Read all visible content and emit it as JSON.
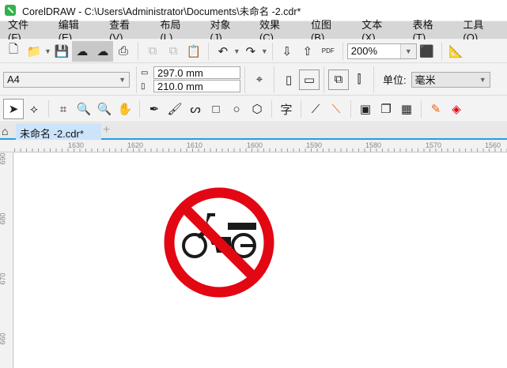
{
  "window": {
    "title": "CorelDRAW - C:\\Users\\Administrator\\Documents\\未命名 -2.cdr*"
  },
  "menu": [
    "文件(F)",
    "编辑(E)",
    "查看(V)",
    "布局(L)",
    "对象(J)",
    "效果(C)",
    "位图(B)",
    "文本(X)",
    "表格(T)",
    "工具(O)"
  ],
  "toolbar": {
    "zoom": "200%",
    "pdf_label": "PDF"
  },
  "property_bar": {
    "page_size": "A4",
    "width": "297.0 mm",
    "height": "210.0 mm",
    "units_label": "单位:",
    "units": "毫米"
  },
  "tabs": [
    {
      "label": "未命名 -2.cdr*"
    }
  ],
  "ruler": {
    "h": [
      "1630",
      "1620",
      "1610",
      "1600",
      "1590",
      "1580",
      "1570",
      "1560"
    ],
    "v": [
      "690",
      "680",
      "670",
      "660"
    ]
  },
  "colors": {
    "sign_red": "#e30613",
    "accent": "#1fa0e8"
  }
}
